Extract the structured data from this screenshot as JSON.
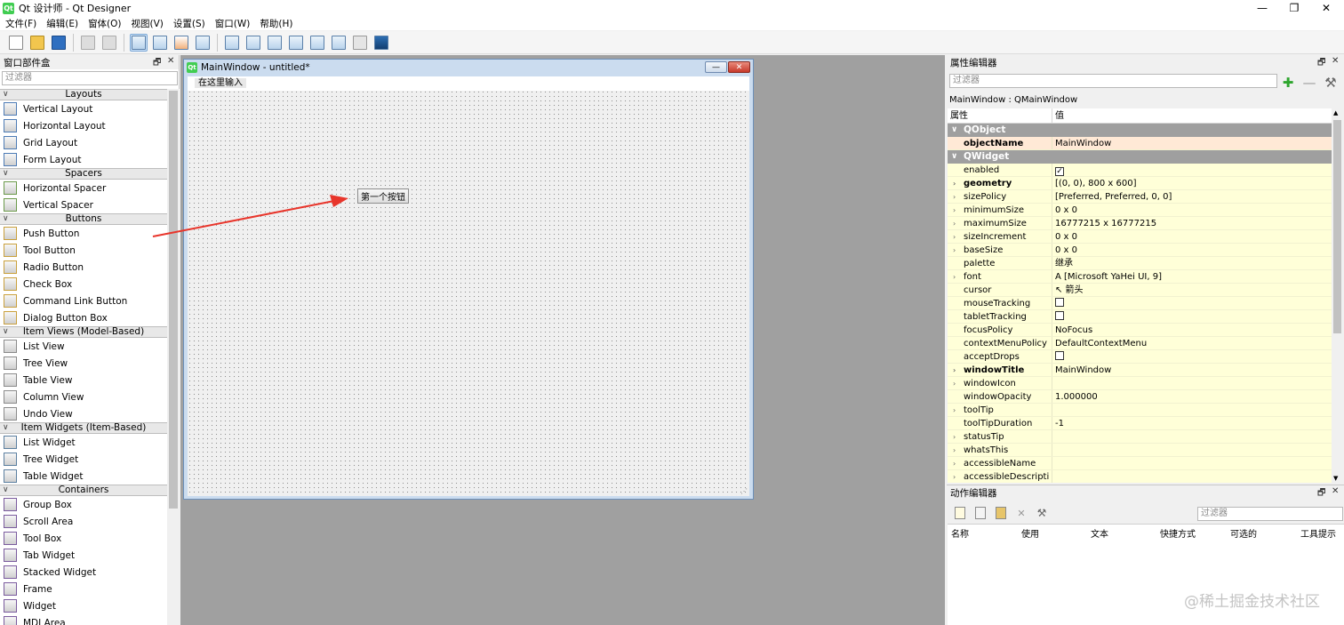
{
  "window": {
    "title": "Qt 设计师 - Qt Designer",
    "minimize": "—",
    "maximize": "❐",
    "close": "✕"
  },
  "menubar": [
    "文件(F)",
    "编辑(E)",
    "窗体(O)",
    "视图(V)",
    "设置(S)",
    "窗口(W)",
    "帮助(H)"
  ],
  "widget_box": {
    "title": "窗口部件盒",
    "filter_placeholder": "过滤器",
    "categories": [
      {
        "label": "Layouts",
        "items": [
          "Vertical Layout",
          "Horizontal Layout",
          "Grid Layout",
          "Form Layout"
        ]
      },
      {
        "label": "Spacers",
        "items": [
          "Horizontal Spacer",
          "Vertical Spacer"
        ]
      },
      {
        "label": "Buttons",
        "items": [
          "Push Button",
          "Tool Button",
          "Radio Button",
          "Check Box",
          "Command Link Button",
          "Dialog Button Box"
        ]
      },
      {
        "label": "Item Views (Model-Based)",
        "items": [
          "List View",
          "Tree View",
          "Table View",
          "Column View",
          "Undo View"
        ]
      },
      {
        "label": "Item Widgets (Item-Based)",
        "items": [
          "List Widget",
          "Tree Widget",
          "Table Widget"
        ]
      },
      {
        "label": "Containers",
        "items": [
          "Group Box",
          "Scroll Area",
          "Tool Box",
          "Tab Widget",
          "Stacked Widget",
          "Frame",
          "Widget",
          "MDI Area"
        ]
      }
    ]
  },
  "form": {
    "title": "MainWindow - untitled*",
    "menu_placeholder": "在这里输入",
    "button_label": "第一个按钮"
  },
  "property_editor": {
    "title": "属性编辑器",
    "filter_placeholder": "过滤器",
    "object_line": "MainWindow : QMainWindow",
    "col_property": "属性",
    "col_value": "值",
    "groups": [
      {
        "name": "QObject",
        "rows": [
          {
            "name": "objectName",
            "value": "MainWindow",
            "bold": true,
            "expand": false
          }
        ]
      },
      {
        "name": "QWidget",
        "rows": [
          {
            "name": "enabled",
            "value": "",
            "checkbox": "checked",
            "expand": false
          },
          {
            "name": "geometry",
            "value": "[(0, 0), 800 x 600]",
            "bold": true,
            "expand": true
          },
          {
            "name": "sizePolicy",
            "value": "[Preferred, Preferred, 0, 0]",
            "expand": true
          },
          {
            "name": "minimumSize",
            "value": "0 x 0",
            "expand": true
          },
          {
            "name": "maximumSize",
            "value": "16777215 x 16777215",
            "expand": true
          },
          {
            "name": "sizeIncrement",
            "value": "0 x 0",
            "expand": true
          },
          {
            "name": "baseSize",
            "value": "0 x 0",
            "expand": true
          },
          {
            "name": "palette",
            "value": "继承",
            "expand": false
          },
          {
            "name": "font",
            "value": "A  [Microsoft YaHei UI, 9]",
            "expand": true
          },
          {
            "name": "cursor",
            "value": "↖  箭头",
            "expand": false
          },
          {
            "name": "mouseTracking",
            "value": "",
            "checkbox": "unchecked",
            "expand": false
          },
          {
            "name": "tabletTracking",
            "value": "",
            "checkbox": "unchecked",
            "expand": false
          },
          {
            "name": "focusPolicy",
            "value": "NoFocus",
            "expand": false
          },
          {
            "name": "contextMenuPolicy",
            "value": "DefaultContextMenu",
            "expand": false
          },
          {
            "name": "acceptDrops",
            "value": "",
            "checkbox": "unchecked",
            "expand": false
          },
          {
            "name": "windowTitle",
            "value": "MainWindow",
            "bold": true,
            "expand": true
          },
          {
            "name": "windowIcon",
            "value": "",
            "expand": true
          },
          {
            "name": "windowOpacity",
            "value": "1.000000",
            "expand": false
          },
          {
            "name": "toolTip",
            "value": "",
            "expand": true
          },
          {
            "name": "toolTipDuration",
            "value": "-1",
            "expand": false
          },
          {
            "name": "statusTip",
            "value": "",
            "expand": true
          },
          {
            "name": "whatsThis",
            "value": "",
            "expand": true
          },
          {
            "name": "accessibleName",
            "value": "",
            "expand": true
          },
          {
            "name": "accessibleDescripti",
            "value": "",
            "expand": true
          }
        ]
      }
    ]
  },
  "action_editor": {
    "title": "动作编辑器",
    "filter_placeholder": "过滤器",
    "columns": [
      "名称",
      "使用",
      "文本",
      "快捷方式",
      "可选的",
      "工具提示"
    ]
  },
  "watermark": "@稀土掘金技术社区",
  "colors": {
    "accent_arrow": "#e8352b",
    "property_row_bg": "#ffffd8",
    "object_row_bg": "#ffe9d6",
    "group_bg": "#9f9f9f",
    "mdi_bg": "#a0a0a0"
  }
}
